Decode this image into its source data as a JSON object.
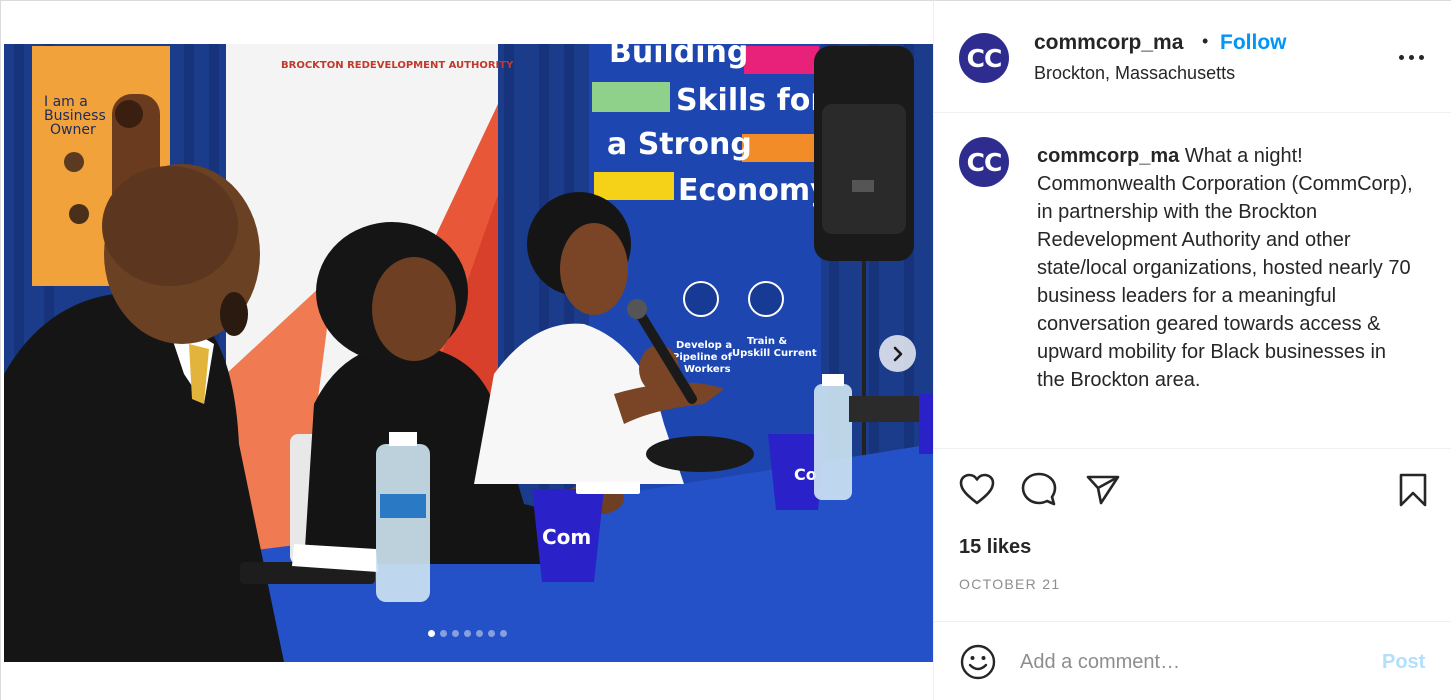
{
  "post": {
    "username": "commcorp_ma",
    "avatar_initials": "CC",
    "separator": "•",
    "follow_label": "Follow",
    "location": "Brockton, Massachusetts",
    "caption_text": "What a night! Commonwealth Corporation (CommCorp), in partnership with the Brockton Redevelopment Authority and other state/local organizations, hosted nearly 70 business leaders for a meaningful conversation geared towards access & upward mobility for Black businesses in the Brockton area.",
    "likes": "15 likes",
    "date": "OCTOBER 21",
    "comment_placeholder": "Add a comment…",
    "post_label": "Post"
  },
  "carousel": {
    "slide_count": 7,
    "active_index": 0
  },
  "photo_text": {
    "authority_banner": "BROCKTON REDEVELOPMENT AUTHORITY",
    "poster_line1": "I am a",
    "poster_line2": "Business",
    "poster_line3": "Owner",
    "banner_line1": "Building",
    "banner_line2": "Skills for",
    "banner_line3": "a Strong",
    "banner_line4": "Economy",
    "banner_item1_line1": "Develop a",
    "banner_item1_line2": "Pipeline of",
    "banner_item1_line3": "Workers",
    "banner_item2_line1": "Train &",
    "banner_item2_line2": "Upskill Current",
    "cup_text": "Com",
    "cup_text_back": "Co"
  },
  "colors": {
    "avatar_bg": "#2e2c8f",
    "follow": "#0095f6",
    "post_disabled": "#b2dffc",
    "muted": "#8e8e8e",
    "tablecloth": "#2451c8"
  },
  "icons": {
    "next": "chevron-right-icon",
    "like": "heart-icon",
    "comment": "comment-icon",
    "share": "paper-plane-icon",
    "save": "bookmark-icon",
    "emoji": "smiley-icon",
    "more": "more-horizontal-icon"
  }
}
